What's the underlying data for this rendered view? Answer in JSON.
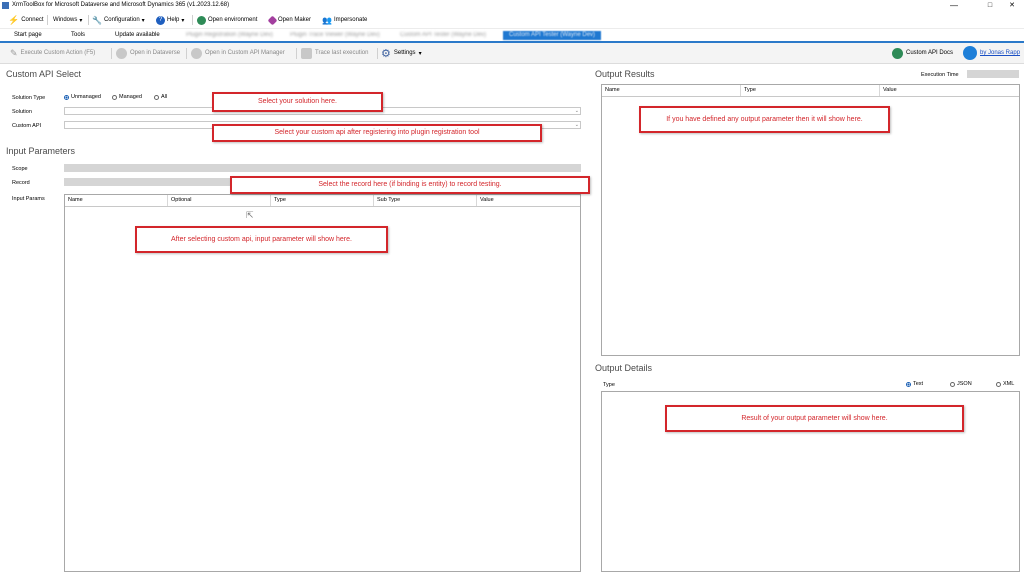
{
  "window": {
    "title": "XrmToolBox for Microsoft Dataverse and Microsoft Dynamics 365 (v1.2023.12.68)",
    "minimize": "—",
    "maximize": "□",
    "close": "✕"
  },
  "menu": {
    "connect": "Connect",
    "windows": "Windows",
    "configuration": "Configuration",
    "help": "Help",
    "open_environment": "Open environment",
    "open_maker": "Open Maker",
    "impersonate": "Impersonate",
    "dropdown_marker": "▾"
  },
  "tabs": {
    "start_page": "Start page",
    "tools": "Tools",
    "update_available": "Update available",
    "blurred": [
      "Plugin Registration (Wayne Dev)",
      "Plugin Trace Viewer (Wayne Dev)",
      "Custom API Tester (Wayne Dev)"
    ],
    "active": "Custom API Tester (Wayne Dev)"
  },
  "toolbar": {
    "execute": "Execute Custom Action (F5)",
    "open_dataverse": "Open in Dataverse",
    "open_manager": "Open in Custom API Manager",
    "trace_last": "Trace last execution",
    "settings": "Settings",
    "settings_marker": "▾",
    "custom_api_docs": "Custom API Docs",
    "by_jonas": "by Jonas Rapp"
  },
  "custom_api_select": {
    "heading": "Custom API Select",
    "solution_type_label": "Solution Type",
    "options": [
      "Unmanaged",
      "Managed",
      "All"
    ],
    "selected_option": "Unmanaged",
    "solution_label": "Solution",
    "custom_api_label": "Custom API"
  },
  "input_parameters": {
    "heading": "Input Parameters",
    "scope_label": "Scope",
    "record_label": "Record",
    "record_button": "...",
    "input_params_label": "Input Params",
    "columns": [
      "Name",
      "Optional",
      "Type",
      "Sub Type",
      "Value"
    ]
  },
  "output_results": {
    "heading": "Output Results",
    "execution_time_label": "Execution Time",
    "columns": [
      "Name",
      "Type",
      "Value"
    ]
  },
  "output_details": {
    "heading": "Output Details",
    "type_label": "Type",
    "options": [
      "Text",
      "JSON",
      "XML"
    ],
    "selected_option": "Text"
  },
  "annotations": {
    "select_solution": "Select your solution here.",
    "select_custom_api": "Select your custom api after registering into plugin registration tool",
    "select_record": "Select the record here (if binding is entity) to record testing.",
    "input_params_note": "After selecting custom api, input parameter will show here.",
    "output_params_note": "If you have defined any output parameter then it will show here.",
    "output_result_note": "Result of your output parameter will show here."
  },
  "colors": {
    "annotation_red": "#d3262b",
    "active_tab_blue": "#1f78d1",
    "heading_gray": "#4a4a4a"
  }
}
